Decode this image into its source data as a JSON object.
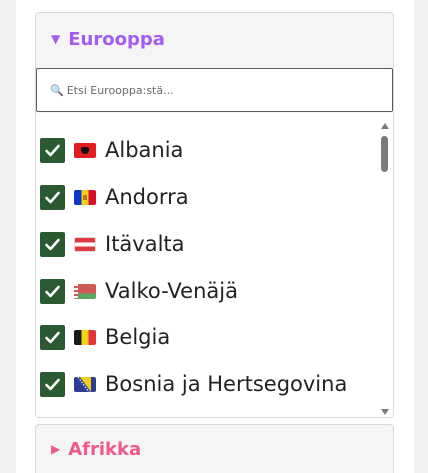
{
  "colors": {
    "europe_accent": "#a45cf0",
    "africa_accent": "#f0598d",
    "checkbox_fill": "#2b5a32"
  },
  "europe": {
    "caret_icon": "triangle-down-icon",
    "title": "Eurooppa",
    "search": {
      "icon": "magnifier-icon",
      "placeholder": "Etsi Eurooppa:stä..."
    },
    "countries": [
      {
        "label": "Albania",
        "checked": true,
        "flag": "albania-flag-icon"
      },
      {
        "label": "Andorra",
        "checked": true,
        "flag": "andorra-flag-icon"
      },
      {
        "label": "Itävalta",
        "checked": true,
        "flag": "austria-flag-icon"
      },
      {
        "label": "Valko-Venäjä",
        "checked": true,
        "flag": "belarus-flag-icon"
      },
      {
        "label": "Belgia",
        "checked": true,
        "flag": "belgium-flag-icon"
      },
      {
        "label": "Bosnia ja Hertsegovina",
        "checked": true,
        "flag": "bosnia-flag-icon"
      }
    ]
  },
  "africa": {
    "caret_icon": "triangle-right-icon",
    "title": "Afrikka"
  }
}
